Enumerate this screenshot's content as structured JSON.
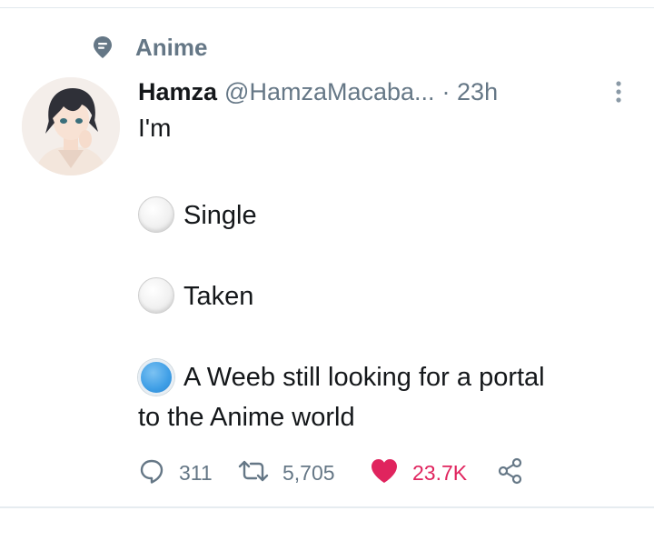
{
  "context": {
    "label": "Anime",
    "icon": "pin-icon"
  },
  "tweet": {
    "author_name": "Hamza",
    "author_handle": "@HamzaMacaba...",
    "time": "· 23h",
    "text": "I'm",
    "options": [
      {
        "label": "Single",
        "selected": false
      },
      {
        "label": "Taken",
        "selected": false
      },
      {
        "label": "A Weeb still looking for a portal",
        "label_line2": "to the Anime world",
        "selected": true
      }
    ],
    "stats": {
      "replies": "311",
      "retweets": "5,705",
      "likes": "23.7K"
    }
  },
  "next_tweet_preview": "…",
  "colors": {
    "text": "#14171a",
    "muted": "#657786",
    "like": "#e0245e",
    "selected": "#3e9ee6"
  }
}
